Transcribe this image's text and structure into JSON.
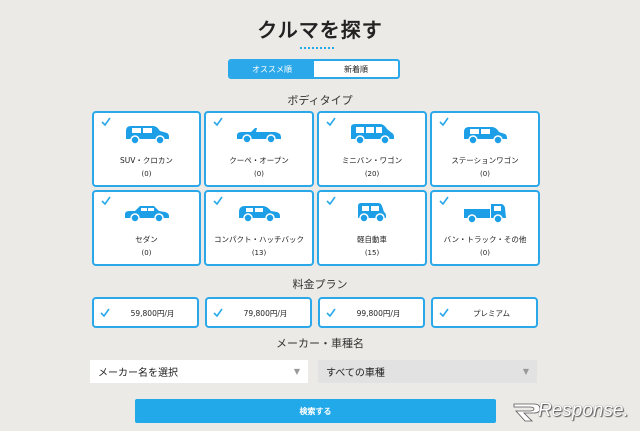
{
  "title": "クルマを探す",
  "sort_tabs": [
    {
      "label": "オススメ順",
      "active": true
    },
    {
      "label": "新着順",
      "active": false
    }
  ],
  "body_type": {
    "heading": "ボディタイプ",
    "items": [
      {
        "name": "SUV・クロカン",
        "count": "(0)",
        "icon": "suv-icon",
        "checked": true
      },
      {
        "name": "クーペ・オープン",
        "count": "(0)",
        "icon": "convertible-icon",
        "checked": true
      },
      {
        "name": "ミニバン・ワゴン",
        "count": "(20)",
        "icon": "minivan-icon",
        "checked": true
      },
      {
        "name": "ステーションワゴン",
        "count": "(0)",
        "icon": "station-wagon-icon",
        "checked": true
      },
      {
        "name": "セダン",
        "count": "(0)",
        "icon": "sedan-icon",
        "checked": true
      },
      {
        "name": "コンパクト・ハッチバック",
        "count": "(13)",
        "icon": "hatchback-icon",
        "checked": true
      },
      {
        "name": "軽自動車",
        "count": "(15)",
        "icon": "kei-car-icon",
        "checked": true
      },
      {
        "name": "バン・トラック・その他",
        "count": "(0)",
        "icon": "truck-icon",
        "checked": true
      }
    ]
  },
  "price_plan": {
    "heading": "料金プラン",
    "items": [
      {
        "label": "59,800円/月",
        "checked": true
      },
      {
        "label": "79,800円/月",
        "checked": true
      },
      {
        "label": "99,800円/月",
        "checked": true
      },
      {
        "label": "プレミアム",
        "checked": true
      }
    ]
  },
  "maker": {
    "heading": "メーカー・車種名",
    "maker_select": "メーカー名を選択",
    "model_select": "すべての車種"
  },
  "search_button": "検索する",
  "watermark": "Response.",
  "colors": {
    "accent": "#2aa8ea",
    "background": "#eceae6"
  }
}
